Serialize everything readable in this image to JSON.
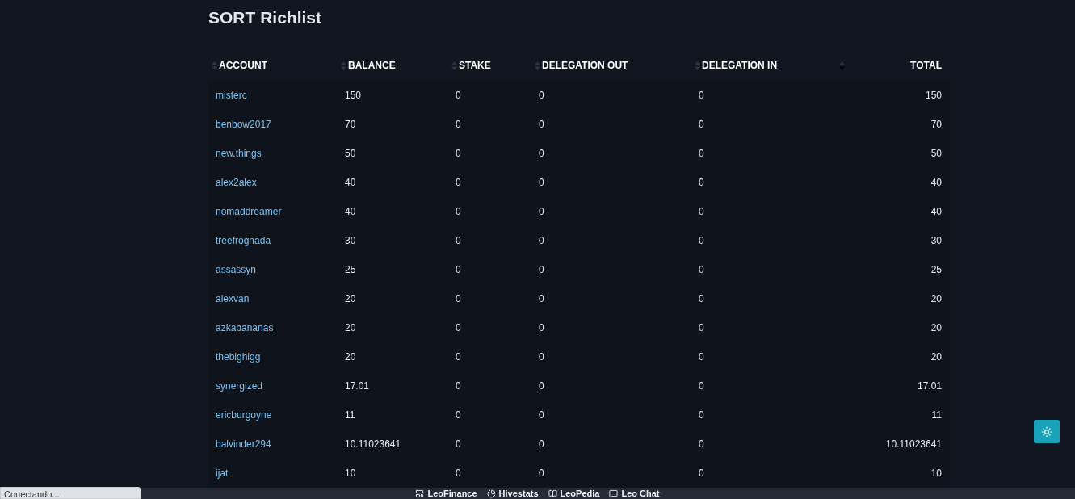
{
  "title": "SORT Richlist",
  "columns": [
    {
      "label": "ACCOUNT",
      "sorted": false
    },
    {
      "label": "BALANCE",
      "sorted": false
    },
    {
      "label": "STAKE",
      "sorted": false
    },
    {
      "label": "DELEGATION OUT",
      "sorted": false
    },
    {
      "label": "DELEGATION IN",
      "sorted": false
    },
    {
      "label": "TOTAL",
      "sorted": true
    }
  ],
  "rows": [
    [
      "misterc",
      "150",
      "0",
      "0",
      "0",
      "150"
    ],
    [
      "benbow2017",
      "70",
      "0",
      "0",
      "0",
      "70"
    ],
    [
      "new.things",
      "50",
      "0",
      "0",
      "0",
      "50"
    ],
    [
      "alex2alex",
      "40",
      "0",
      "0",
      "0",
      "40"
    ],
    [
      "nomaddreamer",
      "40",
      "0",
      "0",
      "0",
      "40"
    ],
    [
      "treefrognada",
      "30",
      "0",
      "0",
      "0",
      "30"
    ],
    [
      "assassyn",
      "25",
      "0",
      "0",
      "0",
      "25"
    ],
    [
      "alexvan",
      "20",
      "0",
      "0",
      "0",
      "20"
    ],
    [
      "azkabananas",
      "20",
      "0",
      "0",
      "0",
      "20"
    ],
    [
      "thebighigg",
      "20",
      "0",
      "0",
      "0",
      "20"
    ],
    [
      "synergized",
      "17.01",
      "0",
      "0",
      "0",
      "17.01"
    ],
    [
      "ericburgoyne",
      "11",
      "0",
      "0",
      "0",
      "11"
    ],
    [
      "balvinder294",
      "10.11023641",
      "0",
      "0",
      "0",
      "10.11023641"
    ],
    [
      "ijat",
      "10",
      "0",
      "0",
      "0",
      "10"
    ]
  ],
  "footer_links": [
    {
      "label": "LeoFinance"
    },
    {
      "label": "Hivestats"
    },
    {
      "label": "LeoPedia"
    },
    {
      "label": "Leo Chat"
    }
  ],
  "status": "Conectando..."
}
